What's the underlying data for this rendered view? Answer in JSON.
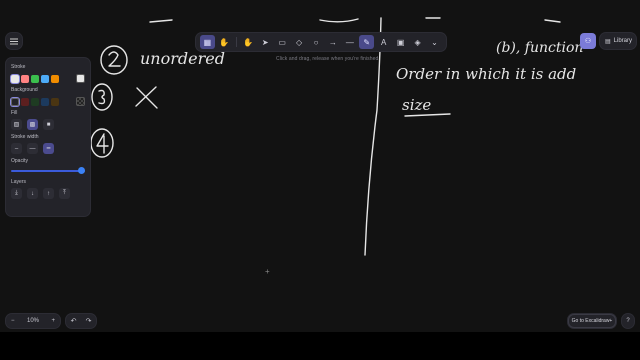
{
  "toolbar": {
    "tools": [
      "lock-icon",
      "hand-icon",
      "selection-icon",
      "rectangle-icon",
      "diamond-icon",
      "ellipse-icon",
      "arrow-icon",
      "line-icon",
      "pencil-icon",
      "text-icon",
      "image-icon",
      "eraser-icon",
      "more-tools-icon"
    ],
    "active_tool": "pencil-icon"
  },
  "hint": "Click and drag, release when you're finished",
  "library_label": "Library",
  "panel": {
    "stroke_title": "Stroke",
    "stroke_colors": [
      "#e8e8e8",
      "#ff8383",
      "#3bbf4e",
      "#4dabf7",
      "#f08c00",
      "#e8e8e8"
    ],
    "background_title": "Background",
    "background_colors": [
      "transparent",
      "#5c1f1f",
      "#1e3b22",
      "#1c3a5e",
      "#4a3512",
      "checker"
    ],
    "fill_title": "Fill",
    "stroke_width_title": "Stroke width",
    "opacity_title": "Opacity",
    "opacity_value": 100,
    "layers_title": "Layers"
  },
  "footer": {
    "zoom_minus": "−",
    "zoom_level": "10%",
    "zoom_plus": "+",
    "excalidraw_plus": "Go to Excalidraw+"
  },
  "canvas_text": {
    "left_words": "unordered",
    "right_line1": "Order in which it is add",
    "right_line2": "size",
    "top_right": "(b), function"
  },
  "accent": "#7b7bd8"
}
